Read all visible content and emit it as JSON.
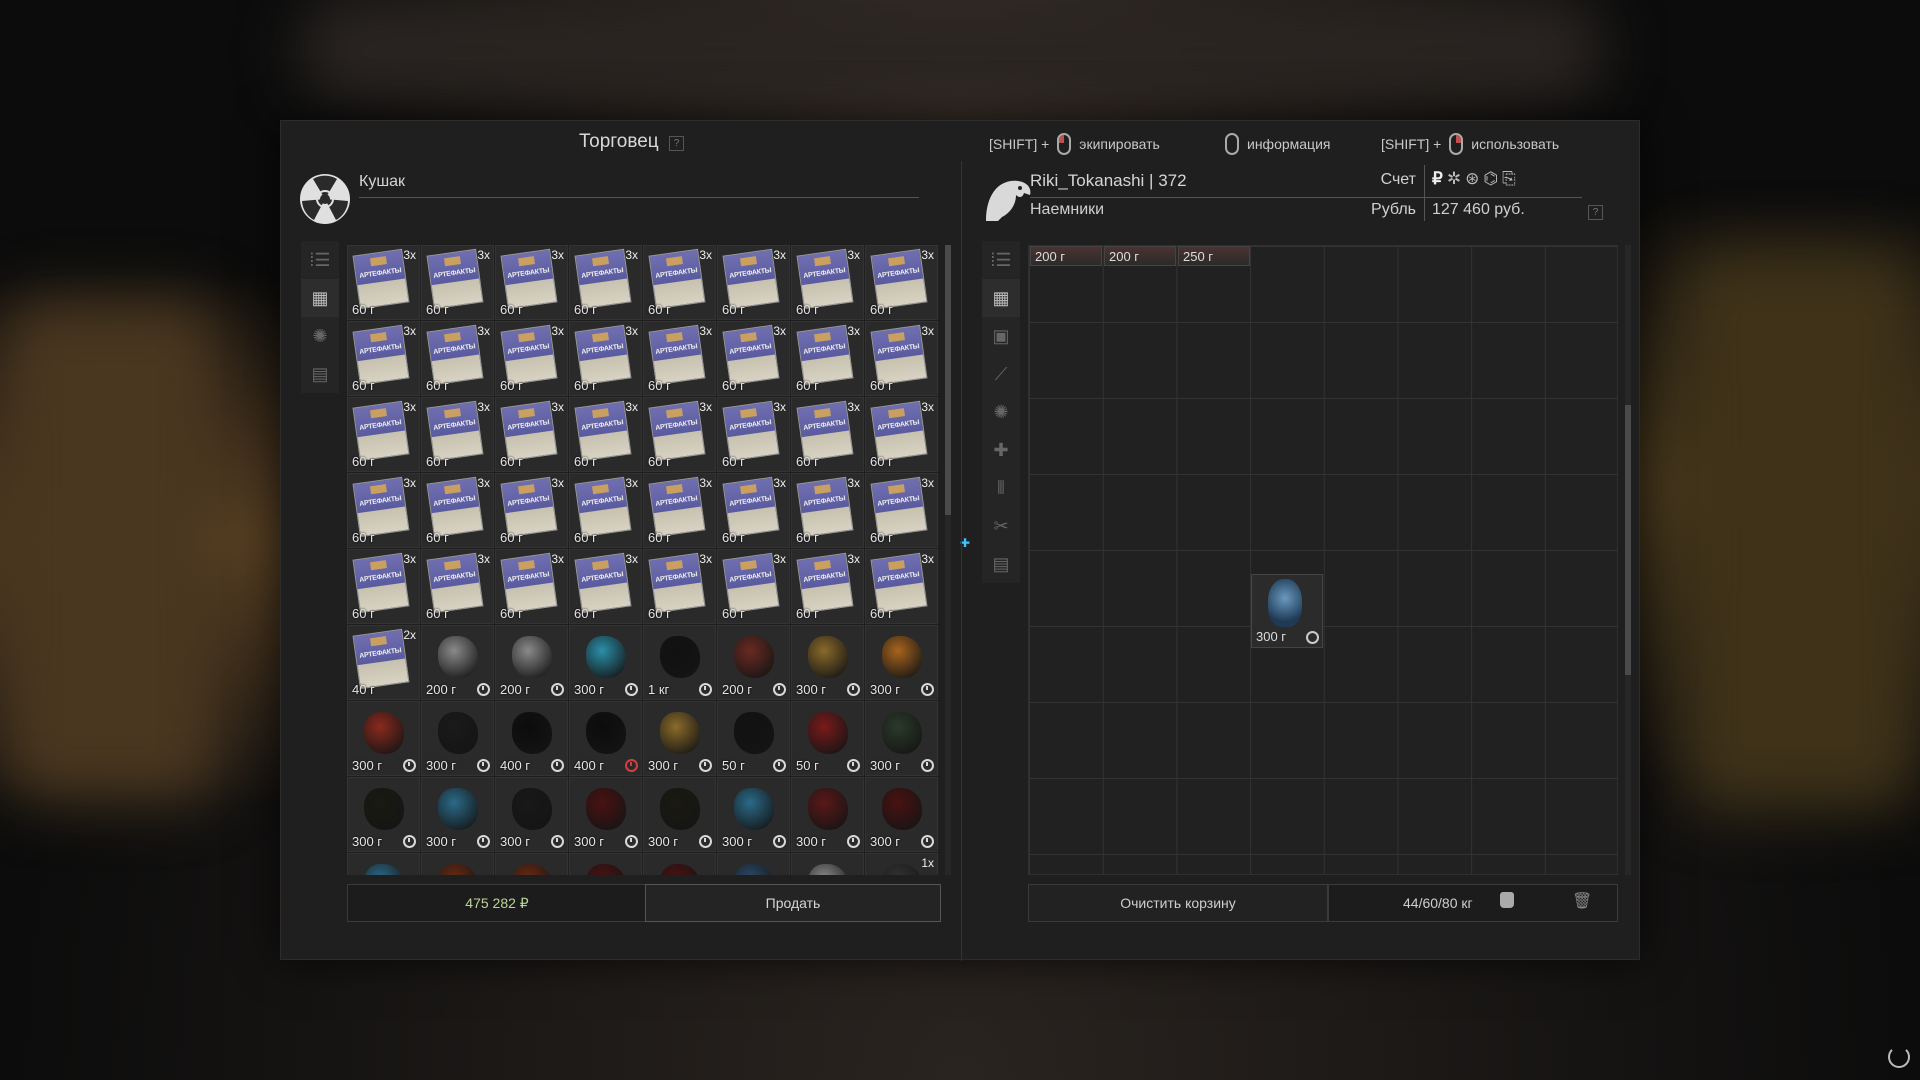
{
  "header": {
    "title": "Торговец",
    "help": "?",
    "hints": [
      {
        "prefix": "[SHIFT] +",
        "mouse": "left",
        "label": "экипировать"
      },
      {
        "prefix": "",
        "mouse": "right-plain",
        "label": "информация"
      },
      {
        "prefix": "[SHIFT] +",
        "mouse": "right",
        "label": "использовать"
      }
    ]
  },
  "trader": {
    "name": "Кушак",
    "icon": "radiation-icon",
    "side_tabs": [
      "sort-icon",
      "grid-icon",
      "artifact-icon",
      "box-icon"
    ],
    "sum": "475 282 ₽",
    "sell_label": "Продать",
    "items": [
      {
        "t": "book",
        "q": "3x",
        "w": "60 г"
      },
      {
        "t": "book",
        "q": "3x",
        "w": "60 г"
      },
      {
        "t": "book",
        "q": "3x",
        "w": "60 г"
      },
      {
        "t": "book",
        "q": "3x",
        "w": "60 г"
      },
      {
        "t": "book",
        "q": "3x",
        "w": "60 г"
      },
      {
        "t": "book",
        "q": "3x",
        "w": "60 г"
      },
      {
        "t": "book",
        "q": "3x",
        "w": "60 г"
      },
      {
        "t": "book",
        "q": "3x",
        "w": "60 г"
      },
      {
        "t": "book",
        "q": "3x",
        "w": "60 г"
      },
      {
        "t": "book",
        "q": "3x",
        "w": "60 г"
      },
      {
        "t": "book",
        "q": "3x",
        "w": "60 г"
      },
      {
        "t": "book",
        "q": "3x",
        "w": "60 г"
      },
      {
        "t": "book",
        "q": "3x",
        "w": "60 г"
      },
      {
        "t": "book",
        "q": "3x",
        "w": "60 г"
      },
      {
        "t": "book",
        "q": "3x",
        "w": "60 г"
      },
      {
        "t": "book",
        "q": "3x",
        "w": "60 г"
      },
      {
        "t": "book",
        "q": "3x",
        "w": "60 г"
      },
      {
        "t": "book",
        "q": "3x",
        "w": "60 г"
      },
      {
        "t": "book",
        "q": "3x",
        "w": "60 г"
      },
      {
        "t": "book",
        "q": "3x",
        "w": "60 г"
      },
      {
        "t": "book",
        "q": "3x",
        "w": "60 г"
      },
      {
        "t": "book",
        "q": "3x",
        "w": "60 г"
      },
      {
        "t": "book",
        "q": "3x",
        "w": "60 г"
      },
      {
        "t": "book",
        "q": "3x",
        "w": "60 г"
      },
      {
        "t": "book",
        "q": "3x",
        "w": "60 г"
      },
      {
        "t": "book",
        "q": "3x",
        "w": "60 г"
      },
      {
        "t": "book",
        "q": "3x",
        "w": "60 г"
      },
      {
        "t": "book",
        "q": "3x",
        "w": "60 г"
      },
      {
        "t": "book",
        "q": "3x",
        "w": "60 г"
      },
      {
        "t": "book",
        "q": "3x",
        "w": "60 г"
      },
      {
        "t": "book",
        "q": "3x",
        "w": "60 г"
      },
      {
        "t": "book",
        "q": "3x",
        "w": "60 г"
      },
      {
        "t": "book",
        "q": "3x",
        "w": "60 г"
      },
      {
        "t": "book",
        "q": "3x",
        "w": "60 г"
      },
      {
        "t": "book",
        "q": "3x",
        "w": "60 г"
      },
      {
        "t": "book",
        "q": "3x",
        "w": "60 г"
      },
      {
        "t": "book",
        "q": "3x",
        "w": "60 г"
      },
      {
        "t": "book",
        "q": "3x",
        "w": "60 г"
      },
      {
        "t": "book",
        "q": "3x",
        "w": "60 г"
      },
      {
        "t": "book",
        "q": "3x",
        "w": "60 г"
      },
      {
        "t": "book",
        "q": "2x",
        "w": "40 г"
      },
      {
        "t": "art",
        "c": "#8a8a8a",
        "w": "200 г",
        "tm": "w"
      },
      {
        "t": "art",
        "c": "#8a8a8a",
        "w": "200 г",
        "tm": "w"
      },
      {
        "t": "art",
        "c": "#2a8fa8",
        "w": "300 г",
        "tm": "w"
      },
      {
        "t": "art",
        "c": "#111",
        "w": "1 кг",
        "tm": "w"
      },
      {
        "t": "art",
        "c": "#6a2a22",
        "w": "200 г",
        "tm": "w"
      },
      {
        "t": "art",
        "c": "#8a6a2a",
        "w": "300 г",
        "tm": "w"
      },
      {
        "t": "art",
        "c": "#a8641e",
        "w": "300 г",
        "tm": "w"
      },
      {
        "t": "art",
        "c": "#8a2a1e",
        "w": "300 г",
        "tm": "w"
      },
      {
        "t": "art",
        "c": "#1a1a1a",
        "w": "300 г",
        "tm": "w"
      },
      {
        "t": "art",
        "c": "#0c0c0c",
        "w": "400 г",
        "tm": "w"
      },
      {
        "t": "art",
        "c": "#0c0c0c",
        "w": "400 г",
        "tm": "r"
      },
      {
        "t": "art",
        "c": "#8a6a2a",
        "w": "300 г",
        "tm": "w"
      },
      {
        "t": "art",
        "c": "#111",
        "w": "50 г",
        "tm": "w"
      },
      {
        "t": "art",
        "c": "#7a1a1a",
        "w": "50 г",
        "tm": "w"
      },
      {
        "t": "art",
        "c": "#2a3a2a",
        "w": "300 г",
        "tm": "w"
      },
      {
        "t": "art",
        "c": "#1a1a12",
        "w": "300 г",
        "tm": "w"
      },
      {
        "t": "art",
        "c": "#2a6a88",
        "w": "300 г",
        "tm": "w"
      },
      {
        "t": "art",
        "c": "#181818",
        "w": "300 г",
        "tm": "w"
      },
      {
        "t": "art",
        "c": "#4a1212",
        "w": "300 г",
        "tm": "w"
      },
      {
        "t": "art",
        "c": "#1a1a12",
        "w": "300 г",
        "tm": "w"
      },
      {
        "t": "art",
        "c": "#2a6a88",
        "w": "300 г",
        "tm": "w"
      },
      {
        "t": "art",
        "c": "#5a1818",
        "w": "300 г",
        "tm": "w"
      },
      {
        "t": "art",
        "c": "#4a1212",
        "w": "300 г",
        "tm": "w"
      },
      {
        "t": "art",
        "c": "#2a6a88",
        "w": ""
      },
      {
        "t": "art",
        "c": "#6a2a12",
        "w": ""
      },
      {
        "t": "art",
        "c": "#6a2a12",
        "w": ""
      },
      {
        "t": "art",
        "c": "#4a1212",
        "w": ""
      },
      {
        "t": "art",
        "c": "#4a1212",
        "w": ""
      },
      {
        "t": "art",
        "c": "#2a4a6a",
        "w": ""
      },
      {
        "t": "art",
        "c": "#8a8a8a",
        "w": ""
      },
      {
        "t": "art",
        "c": "#333",
        "w": "",
        "q": "1x"
      }
    ]
  },
  "player": {
    "name_level": "Riki_Tokanashi | 372",
    "faction": "Наемники",
    "account_label": "Счет",
    "currency_label": "Рубль",
    "currency_icons": [
      "₽",
      "✲",
      "⊛",
      "⌬",
      "⎘"
    ],
    "balance": "127 460 руб.",
    "balance_help": "?",
    "side_tabs": [
      "sort-icon",
      "grid-icon",
      "backpack-icon",
      "rifle-icon",
      "artifact-icon",
      "medkit-icon",
      "ammo-icon",
      "tools-icon",
      "box-icon"
    ],
    "stash_items": [
      {
        "w": "200 г"
      },
      {
        "w": "200 г"
      },
      {
        "w": "250 г"
      },
      {
        "w": "300 г"
      }
    ],
    "clear_label": "Очистить корзину",
    "weight": "44/60/80 кг"
  }
}
